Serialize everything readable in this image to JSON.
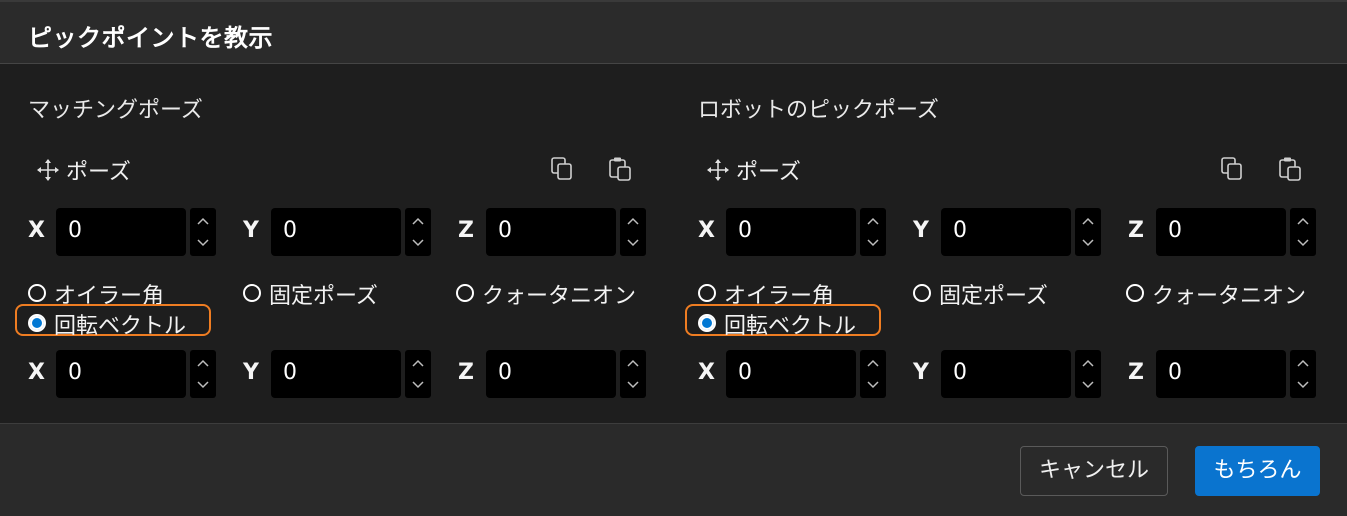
{
  "dialog": {
    "title": "ピックポイントを教示"
  },
  "panels": [
    {
      "section_title": "マッチングポーズ",
      "pose_label": "ポーズ",
      "position": {
        "x": "0",
        "y": "0",
        "z": "0"
      },
      "rotation_modes": [
        "オイラー角",
        "固定ポーズ",
        "クォータニオン",
        "回転ベクトル"
      ],
      "selected_mode": "回転ベクトル",
      "rotation": {
        "x": "0",
        "y": "0",
        "z": "0"
      }
    },
    {
      "section_title": "ロボットのピックポーズ",
      "pose_label": "ポーズ",
      "position": {
        "x": "0",
        "y": "0",
        "z": "0"
      },
      "rotation_modes": [
        "オイラー角",
        "固定ポーズ",
        "クォータニオン",
        "回転ベクトル"
      ],
      "selected_mode": "回転ベクトル",
      "rotation": {
        "x": "0",
        "y": "0",
        "z": "0"
      }
    }
  ],
  "axes": {
    "x": "X",
    "y": "Y",
    "z": "Z"
  },
  "footer": {
    "cancel_label": "キャンセル",
    "ok_label": "もちろん"
  },
  "colors": {
    "accent": "#0a74cf",
    "highlight": "#ef7d22",
    "background": "#1e1e1e"
  }
}
